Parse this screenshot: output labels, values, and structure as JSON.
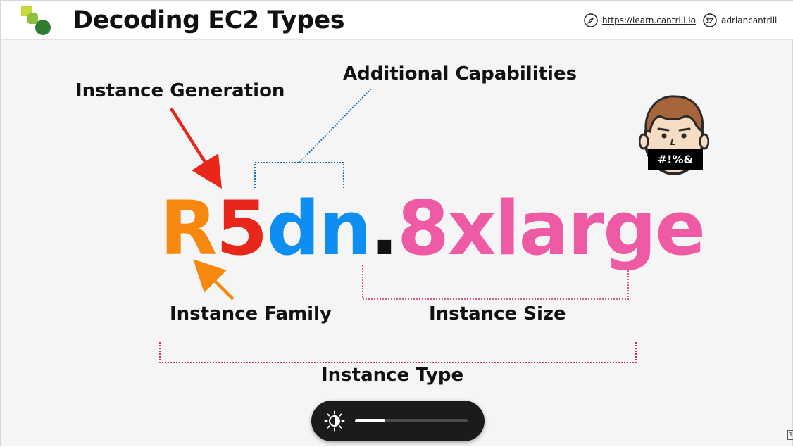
{
  "header": {
    "title": "Decoding EC2 Types",
    "website": "https://learn.cantrill.io",
    "twitter": "adriancantrill",
    "compass_icon": "compass-icon",
    "twitter_icon": "twitter-bird-icon"
  },
  "diagram": {
    "instance_generation": "Instance Generation",
    "additional_capabilities": "Additional Capabilities",
    "instance_family": "Instance Family",
    "instance_size": "Instance Size",
    "instance_type": "Instance Type",
    "parts": {
      "family": "R",
      "generation": "5",
      "capabilities": "dn",
      "dot": ".",
      "size": "8xlarge"
    },
    "colors": {
      "family": "#f7880f",
      "generation": "#e8261a",
      "capabilities": "#0f8ef2",
      "dot": "#111111",
      "size": "#ee5aa4"
    }
  },
  "avatar": {
    "censor_text": "#!%&"
  },
  "player": {
    "brightness_icon": "brightness-icon",
    "brightness_level": 0.27
  },
  "page_number": "1"
}
